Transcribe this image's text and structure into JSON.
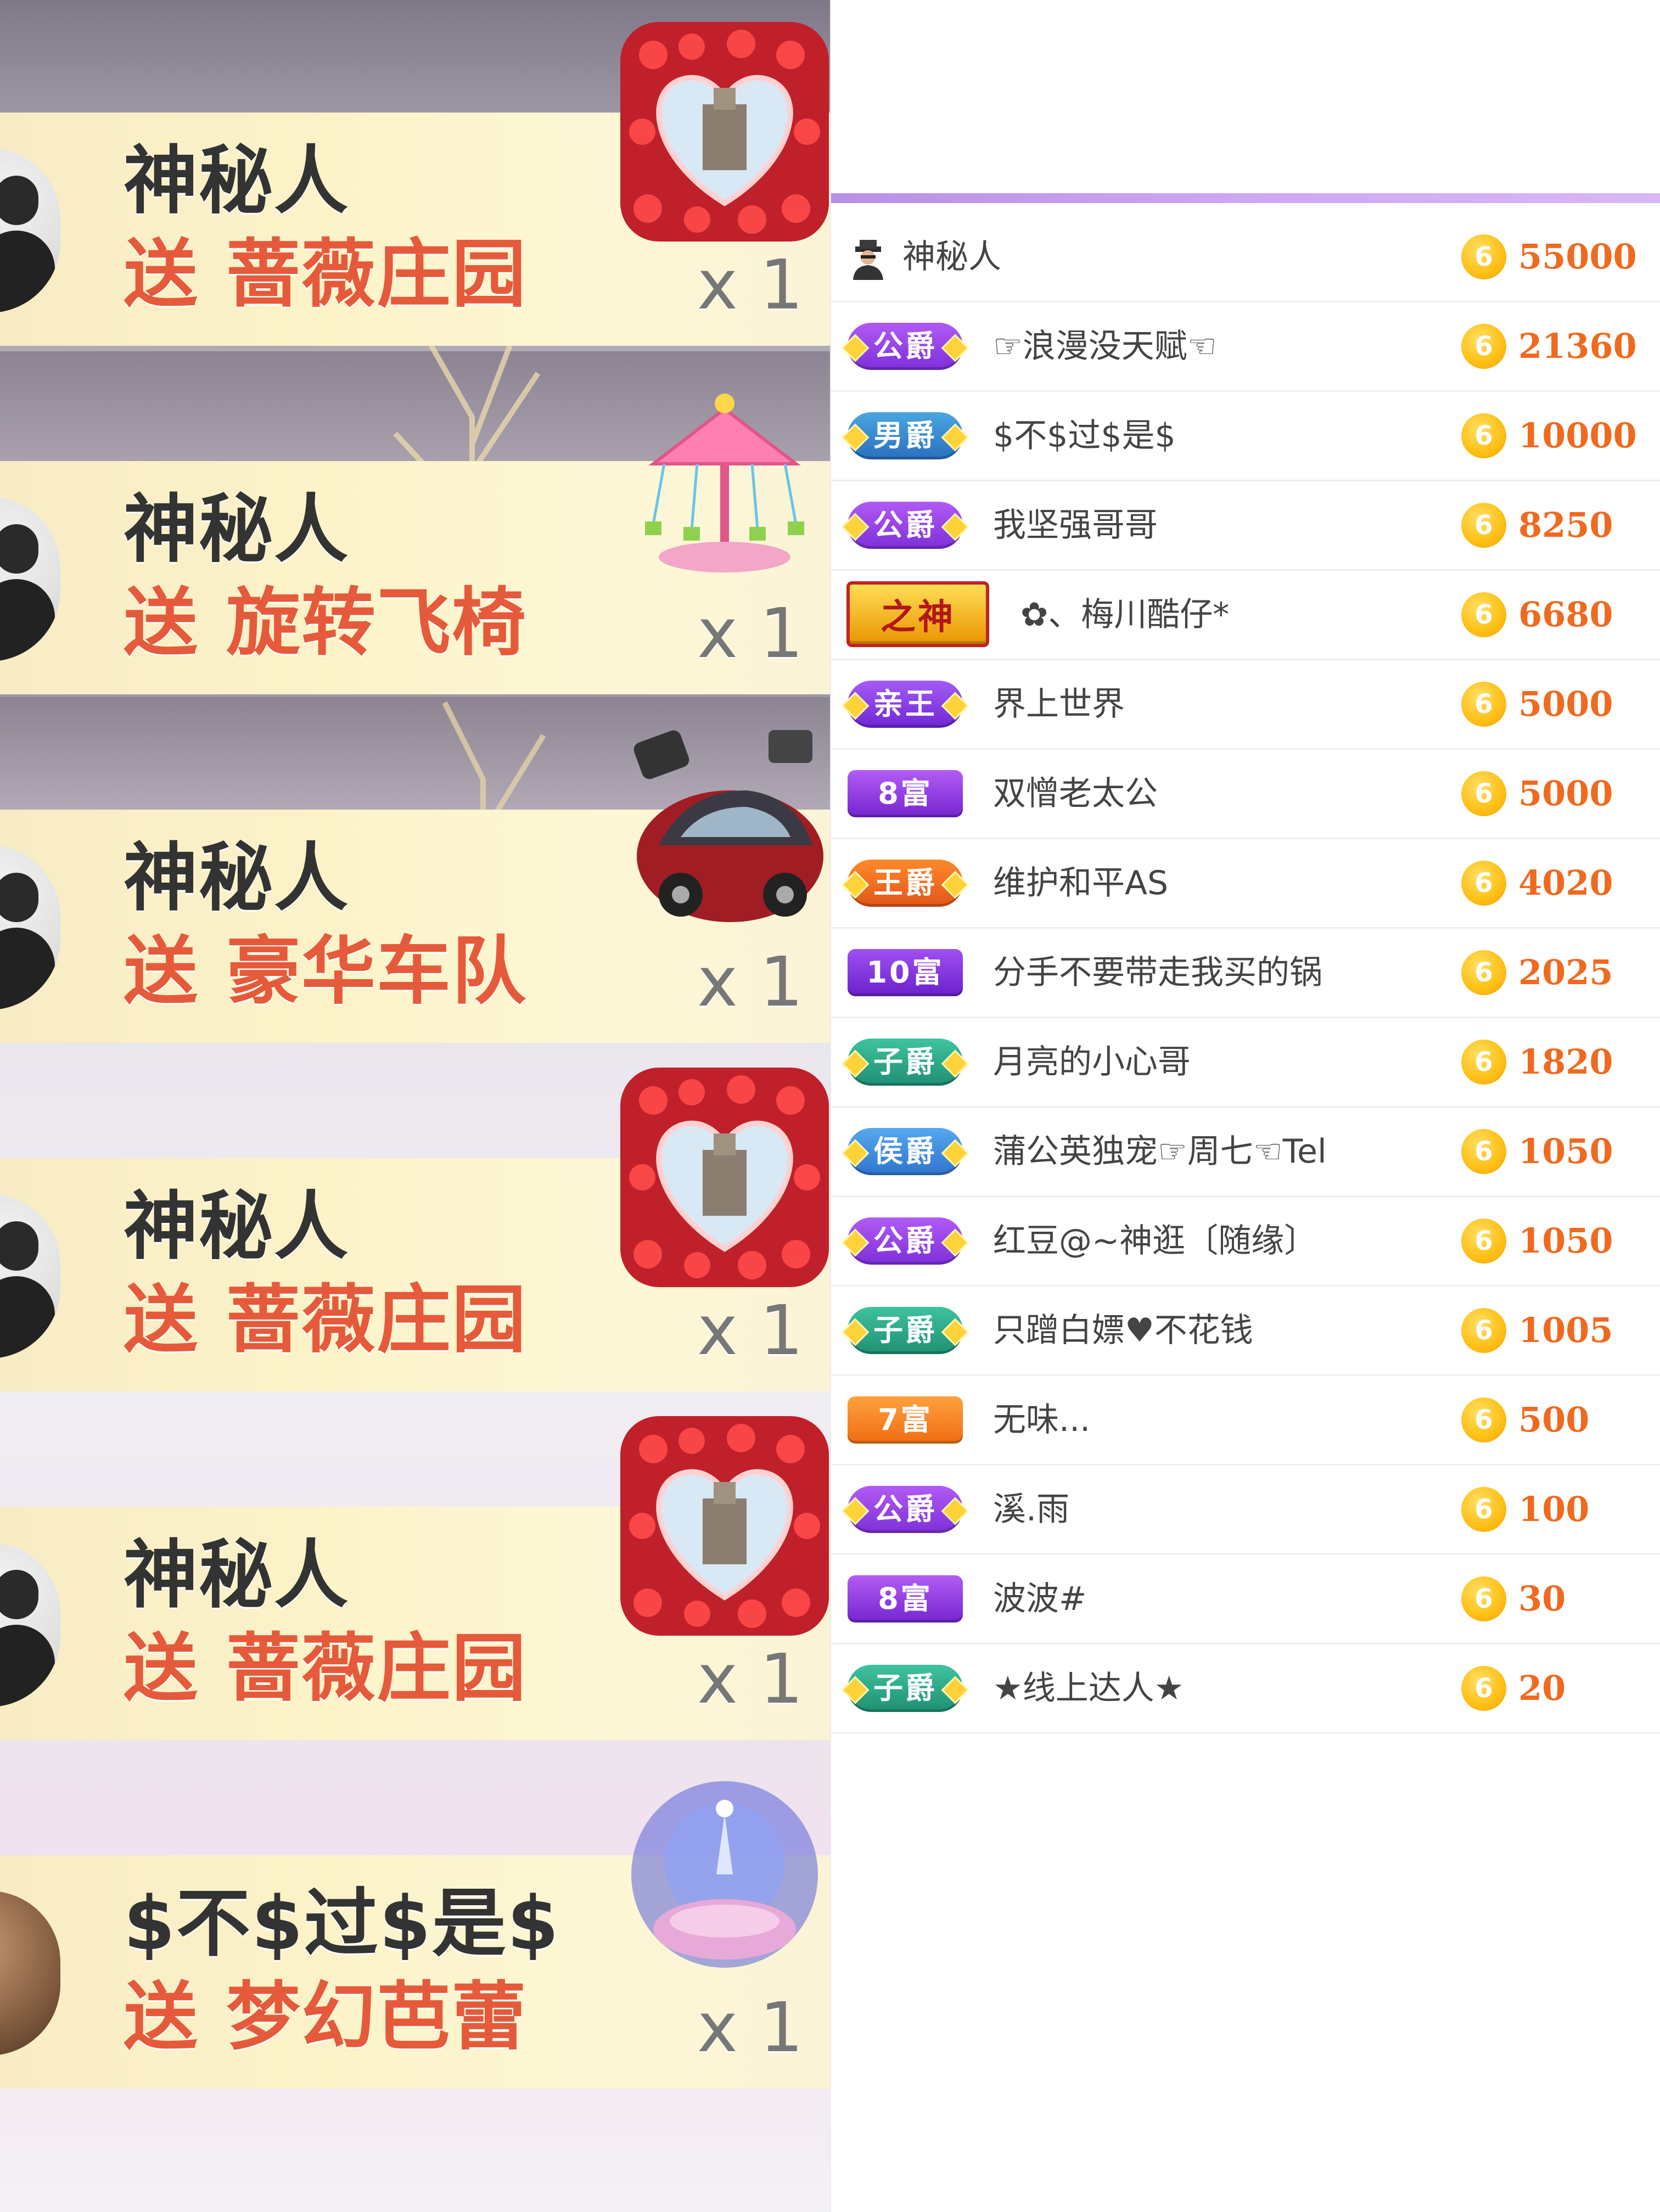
{
  "gift_feed": [
    {
      "user": "神秘人",
      "send_word": "送",
      "gift": "蔷薇庄园",
      "count": "x 1",
      "gift_icon": "rose-manor-icon"
    },
    {
      "user": "神秘人",
      "send_word": "送",
      "gift": "旋转飞椅",
      "count": "x 1",
      "gift_icon": "carousel-swing-icon"
    },
    {
      "user": "神秘人",
      "send_word": "送",
      "gift": "豪华车队",
      "count": "x 1",
      "gift_icon": "luxury-car-icon"
    },
    {
      "user": "神秘人",
      "send_word": "送",
      "gift": "蔷薇庄园",
      "count": "x 1",
      "gift_icon": "rose-manor-icon"
    },
    {
      "user": "神秘人",
      "send_word": "送",
      "gift": "蔷薇庄园",
      "count": "x 1",
      "gift_icon": "rose-manor-icon"
    },
    {
      "user": "$不$过$是$",
      "send_word": "送",
      "gift": "梦幻芭蕾",
      "count": "x 1",
      "gift_icon": "dream-ballet-icon"
    }
  ],
  "ranking": [
    {
      "badge": "",
      "badge_type": "spy",
      "name": "神秘人",
      "value": "55000"
    },
    {
      "badge": "公爵",
      "badge_type": "gong",
      "name": "☞浪漫没天赋☜",
      "value": "21360"
    },
    {
      "badge": "男爵",
      "badge_type": "nan",
      "name": "$不$过$是$",
      "value": "10000"
    },
    {
      "badge": "公爵",
      "badge_type": "gong",
      "name": "我坚强哥哥",
      "value": "8250"
    },
    {
      "badge": "之神",
      "badge_type": "shen",
      "name": "✿、梅川酷仔*",
      "value": "6680"
    },
    {
      "badge": "亲王",
      "badge_type": "qin",
      "name": "界上世界",
      "value": "5000"
    },
    {
      "badge": "8富",
      "badge_type": "fu8",
      "name": "双憎老太公",
      "value": "5000"
    },
    {
      "badge": "王爵",
      "badge_type": "wang",
      "name": "维护和平AS",
      "value": "4020"
    },
    {
      "badge": "10富",
      "badge_type": "fu10",
      "name": "分手不要带走我买的锅",
      "value": "2025"
    },
    {
      "badge": "子爵",
      "badge_type": "zi",
      "name": "月亮的小心哥",
      "value": "1820"
    },
    {
      "badge": "侯爵",
      "badge_type": "hou",
      "name": "蒲公英独宠☞周七☜Tel",
      "value": "1050"
    },
    {
      "badge": "公爵",
      "badge_type": "gong",
      "name": "红豆@~神逛〔随缘〕",
      "value": "1050"
    },
    {
      "badge": "子爵",
      "badge_type": "zi",
      "name": "只蹭白嫖♥不花钱",
      "value": "1005"
    },
    {
      "badge": "7富",
      "badge_type": "fu7",
      "name": "无味...",
      "value": "500"
    },
    {
      "badge": "公爵",
      "badge_type": "gong",
      "name": "溪.雨",
      "value": "100"
    },
    {
      "badge": "8富",
      "badge_type": "fu8",
      "name": "波波#",
      "value": "30"
    },
    {
      "badge": "子爵",
      "badge_type": "zi",
      "name": "★线上达人★",
      "value": "20"
    }
  ],
  "coin_glyph": "6",
  "colors": {
    "accent": "#cfa6f2",
    "value": "#ef6a1f",
    "send": "#e55a3a",
    "banner": "#fcf3c9"
  }
}
